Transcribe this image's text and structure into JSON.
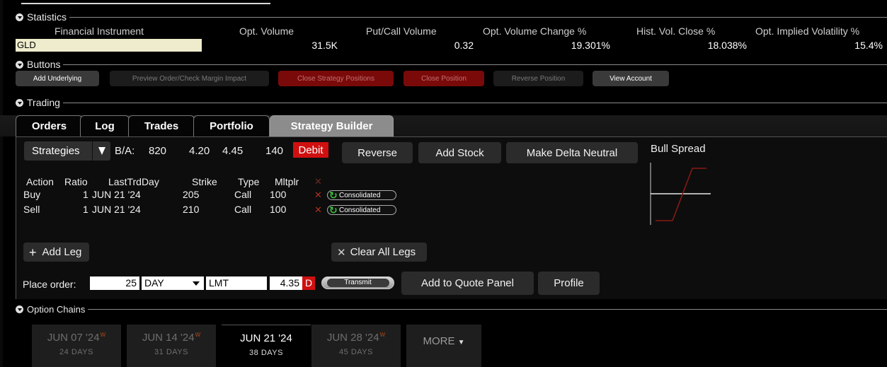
{
  "sections": {
    "statistics": "Statistics",
    "buttons": "Buttons",
    "trading": "Trading",
    "option_chains": "Option Chains"
  },
  "statistics": {
    "headers": [
      "Financial Instrument",
      "Opt. Volume",
      "Put/Call Volume",
      "Opt. Volume Change %",
      "Hist. Vol. Close %",
      "Opt. Implied Volatility %"
    ],
    "instrument": "GLD",
    "values": [
      "31.5K",
      "0.32",
      "19.301%",
      "18.038%",
      "15.4%"
    ]
  },
  "buttons": {
    "add_underlying": "Add Underlying",
    "preview_order": "Preview Order/Check Margin Impact",
    "close_strategy": "Close Strategy Positions",
    "close_position": "Close Position",
    "reverse_position": "Reverse Position",
    "view_account": "View Account"
  },
  "tabs": [
    "Orders",
    "Log",
    "Trades",
    "Portfolio",
    "Strategy Builder"
  ],
  "builder": {
    "strategies": "Strategies",
    "ba_label": "B/A:",
    "bid_size": "820",
    "bid": "4.20",
    "ask": "4.45",
    "ask_size": "140",
    "debit": "Debit",
    "reverse": "Reverse",
    "add_stock": "Add Stock",
    "make_delta_neutral": "Make Delta Neutral",
    "preview_title": "Bull Spread",
    "columns": [
      "Action",
      "Ratio",
      "LastTrdDay",
      "Strike",
      "Type",
      "Mltplr"
    ],
    "legs": [
      {
        "action": "Buy",
        "ratio": "1",
        "last": "JUN 21 '24",
        "strike": "205",
        "type": "Call",
        "mult": "100",
        "route": "Consolidated"
      },
      {
        "action": "Sell",
        "ratio": "1",
        "last": "JUN 21 '24",
        "strike": "210",
        "type": "Call",
        "mult": "100",
        "route": "Consolidated"
      }
    ],
    "add_leg": "Add Leg",
    "clear_all": "Clear All Legs",
    "place_order_label": "Place order:",
    "quantity": "25",
    "tif": "DAY",
    "order_type": "LMT",
    "price": "4.35",
    "price_flag": "D",
    "transmit": "Transmit",
    "add_to_quote": "Add to Quote Panel",
    "profile": "Profile"
  },
  "option_chains": {
    "expiries": [
      {
        "date": "JUN 07 '24",
        "mark": "W",
        "days": "24 DAYS"
      },
      {
        "date": "JUN 14 '24",
        "mark": "W",
        "days": "31 DAYS"
      },
      {
        "date": "JUN 21 '24",
        "mark": "",
        "days": "38 DAYS"
      },
      {
        "date": "JUN 28 '24",
        "mark": "W",
        "days": "45 DAYS"
      }
    ],
    "more": "MORE"
  },
  "colors": {
    "debit_bg": "#d01010",
    "close_btn_bg": "#7a0a0a",
    "instrument_bg": "#eeeccc",
    "payoff_line": "#8a1a14"
  }
}
